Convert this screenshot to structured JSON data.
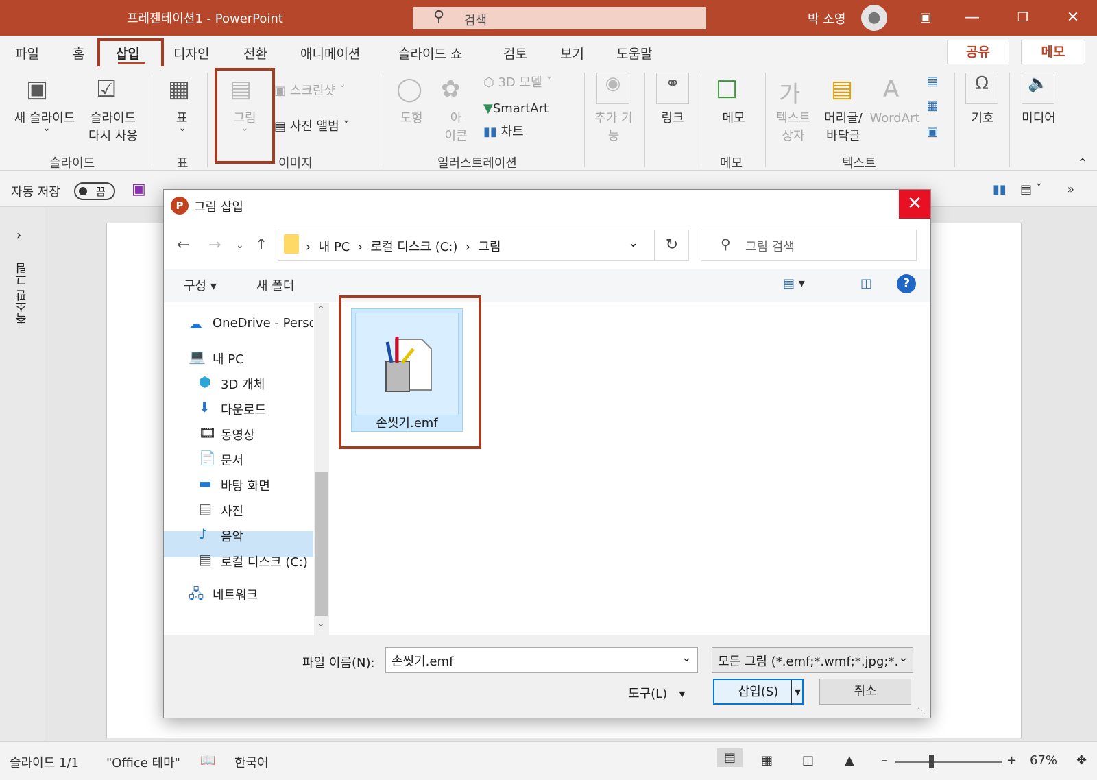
{
  "window": {
    "title": "프레젠테이션1  -  PowerPoint",
    "search_placeholder": "검색",
    "user": "박 소영"
  },
  "tabs": [
    "파일",
    "홈",
    "삽입",
    "디자인",
    "전환",
    "애니메이션",
    "슬라이드 쇼",
    "검토",
    "보기",
    "도움말"
  ],
  "share": {
    "share": "공유",
    "memo": "메모"
  },
  "ribbon": {
    "new_slide": "새 슬라이드",
    "reuse1": "슬라이드",
    "reuse2": "다시 사용",
    "group_slide": "슬라이드",
    "table": "표",
    "group_table": "표",
    "picture": "그림",
    "screenshot": "스크린샷",
    "photo_album": "사진 앨범",
    "group_image": "이미지",
    "shapes": "도형",
    "icons1": "아",
    "icons2": "이콘",
    "model3d": "3D 모델",
    "smartart": "SmartArt",
    "chart": "차트",
    "group_illus": "일러스트레이션",
    "addin1": "추가 기",
    "addin2": "능",
    "link": "링크",
    "comment": "메모",
    "group_memo": "메모",
    "textbox1": "텍스트",
    "textbox2": "상자",
    "header1": "머리글/",
    "header2": "바닥글",
    "wordart": "WordArt",
    "group_text": "텍스트",
    "symbol": "기호",
    "media": "미디어"
  },
  "qat": {
    "autosave": "자동 저장",
    "toggle": "끔"
  },
  "leftpane": "축소판 그림",
  "dialog": {
    "title": "그림 삽입",
    "breadcrumb": [
      "내 PC",
      "로컬 디스크 (C:)",
      "그림"
    ],
    "search_placeholder": "그림 검색",
    "organize": "구성",
    "new_folder": "새 폴더",
    "tree": [
      {
        "label": "OneDrive - Person",
        "icon": "cloud"
      },
      {
        "label": "내 PC",
        "icon": "pc"
      },
      {
        "label": "3D 개체",
        "icon": "cube"
      },
      {
        "label": "다운로드",
        "icon": "download"
      },
      {
        "label": "동영상",
        "icon": "film"
      },
      {
        "label": "문서",
        "icon": "doc"
      },
      {
        "label": "바탕 화면",
        "icon": "desktop"
      },
      {
        "label": "사진",
        "icon": "picture"
      },
      {
        "label": "음악",
        "icon": "music"
      },
      {
        "label": "로컬 디스크 (C:)",
        "icon": "drive"
      },
      {
        "label": "네트워크",
        "icon": "network"
      }
    ],
    "file": {
      "name": "손씻기.emf"
    },
    "filename_label": "파일 이름(N):",
    "filename_value": "손씻기.emf",
    "filetype": "모든 그림 (*.emf;*.wmf;*.jpg;*.",
    "tools": "도구(L)",
    "insert": "삽입(S)",
    "cancel": "취소"
  },
  "status": {
    "slide": "슬라이드 1/1",
    "theme": "\"Office 테마\"",
    "lang": "한국어",
    "zoom": "67%"
  },
  "colors": {
    "accent": "#b7472a",
    "highlight": "#a53c22",
    "selection": "#cce8ff"
  }
}
